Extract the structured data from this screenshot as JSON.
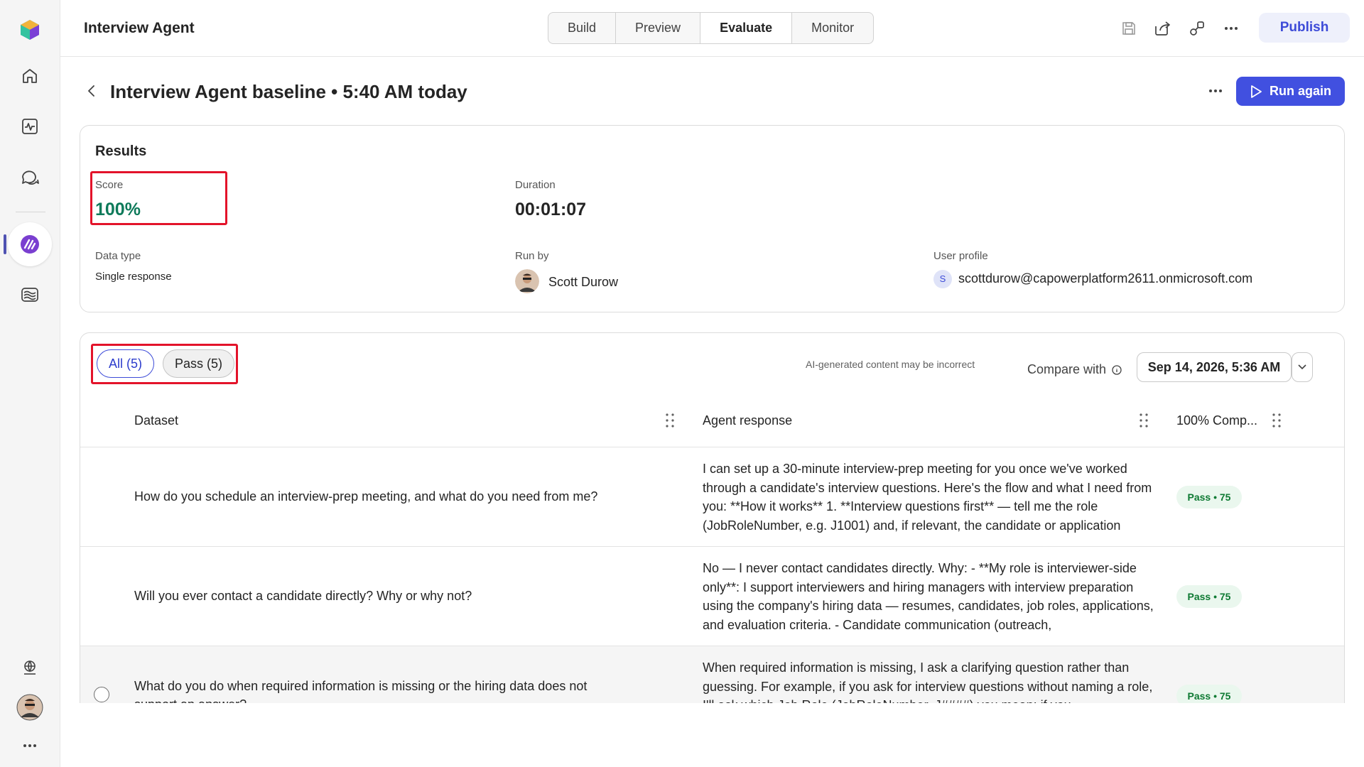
{
  "app": {
    "title": "Interview Agent"
  },
  "tabs": [
    {
      "label": "Build"
    },
    {
      "label": "Preview"
    },
    {
      "label": "Evaluate",
      "active": true
    },
    {
      "label": "Monitor"
    }
  ],
  "header": {
    "publish_label": "Publish",
    "icons": [
      "save-icon",
      "share-icon",
      "connect-icon",
      "more-icon"
    ]
  },
  "rail": {
    "icons": [
      "copilot-logo-icon",
      "home-icon",
      "activity-icon",
      "chat-icon",
      "agent-icon",
      "knowledge-icon",
      "globe-icon",
      "avatar",
      "more-icon"
    ]
  },
  "page": {
    "title": "Interview Agent baseline • 5:40 AM today",
    "run_again_label": "Run again"
  },
  "results": {
    "title": "Results",
    "score_label": "Score",
    "score_value": "100%",
    "duration_label": "Duration",
    "duration_value": "00:01:07",
    "data_type_label": "Data type",
    "data_type_value": "Single response",
    "run_by_label": "Run by",
    "run_by_value": "Scott Durow",
    "user_profile_label": "User profile",
    "user_profile_initial": "S",
    "user_profile_value": "scottdurow@capowerplatform2611.onmicrosoft.com"
  },
  "filters": {
    "all_label": "All (5)",
    "pass_label": "Pass (5)"
  },
  "table_toolbar": {
    "ai_note": "AI-generated content may be incorrect",
    "compare_label": "Compare with",
    "compare_value": "Sep 14, 2026, 5:36 AM"
  },
  "table": {
    "columns": [
      "Dataset",
      "Agent response",
      "100% Comp..."
    ],
    "rows": [
      {
        "question": "How do you schedule an interview-prep meeting, and what do you need from me?",
        "response": "I can set up a 30-minute interview-prep meeting for you once we've worked through a candidate's interview questions. Here's the flow and what I need from you: **How it works** 1. **Interview questions first** — tell me the role (JobRoleNumber, e.g. J1001) and, if relevant, the candidate or application",
        "result": "Pass • 75"
      },
      {
        "question": "Will you ever contact a candidate directly? Why or why not?",
        "response": "No — I never contact candidates directly. Why: - **My role is interviewer-side only**: I support interviewers and hiring managers with interview preparation using the company's hiring data — resumes, candidates, job roles, applications, and evaluation criteria. - Candidate communication (outreach,",
        "result": "Pass • 75"
      },
      {
        "question": "What do you do when required information is missing or the hiring data does not support an answer?",
        "response": "When required information is missing, I ask a clarifying question rather than guessing. For example, if you ask for interview questions without naming a role, I'll ask which Job Role (JobRoleNumber, J####) you mean; if you",
        "result": "Pass • 75"
      }
    ]
  }
}
